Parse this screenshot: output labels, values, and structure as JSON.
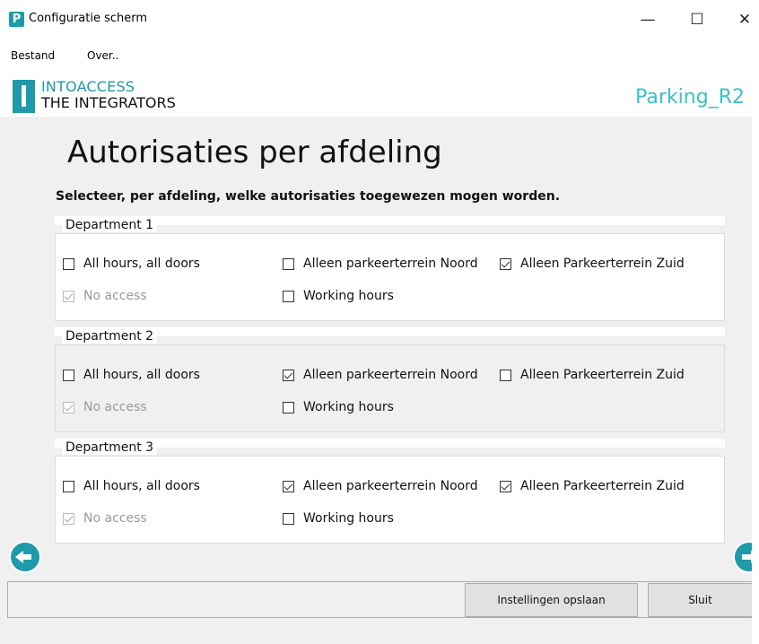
{
  "window": {
    "title": "Configuratie scherm",
    "icon_letter": "P",
    "minimize": "—",
    "maximize": "☐",
    "close": "✕"
  },
  "menu": [
    {
      "label": "Bestand"
    },
    {
      "label": "Over.."
    }
  ],
  "header": {
    "logo_line1": "INTOACCESS",
    "logo_line2": "THE INTEGRATORS",
    "app_name": "Parking_R2",
    "accent_color": "#1f9aa8"
  },
  "page": {
    "title": "Autorisaties per afdeling",
    "subtitle": "Selecteer, per afdeling, welke autorisaties toegewezen mogen worden."
  },
  "departments": [
    {
      "name": "Department 1",
      "options": [
        {
          "label": "All hours, all doors",
          "checked": false,
          "disabled": false
        },
        {
          "label": "Alleen parkeerterrein Noord",
          "checked": false,
          "disabled": false
        },
        {
          "label": "Alleen Parkeerterrein Zuid",
          "checked": true,
          "disabled": false
        },
        {
          "label": "No access",
          "checked": true,
          "disabled": true
        },
        {
          "label": "Working hours",
          "checked": false,
          "disabled": false
        }
      ]
    },
    {
      "name": "Department 2",
      "options": [
        {
          "label": "All hours, all doors",
          "checked": false,
          "disabled": false
        },
        {
          "label": "Alleen parkeerterrein Noord",
          "checked": true,
          "disabled": false
        },
        {
          "label": "Alleen Parkeerterrein Zuid",
          "checked": false,
          "disabled": false
        },
        {
          "label": "No access",
          "checked": true,
          "disabled": true
        },
        {
          "label": "Working hours",
          "checked": false,
          "disabled": false
        }
      ]
    },
    {
      "name": "Department 3",
      "options": [
        {
          "label": "All hours, all doors",
          "checked": false,
          "disabled": false
        },
        {
          "label": "Alleen parkeerterrein Noord",
          "checked": true,
          "disabled": false
        },
        {
          "label": "Alleen Parkeerterrein Zuid",
          "checked": true,
          "disabled": false
        },
        {
          "label": "No access",
          "checked": true,
          "disabled": true
        },
        {
          "label": "Working hours",
          "checked": false,
          "disabled": false
        }
      ]
    }
  ],
  "nav": {
    "prev_icon": "arrow-left-icon",
    "next_icon": "arrow-right-icon"
  },
  "buttons": {
    "save": "Instellingen opslaan",
    "close": "Sluit"
  }
}
